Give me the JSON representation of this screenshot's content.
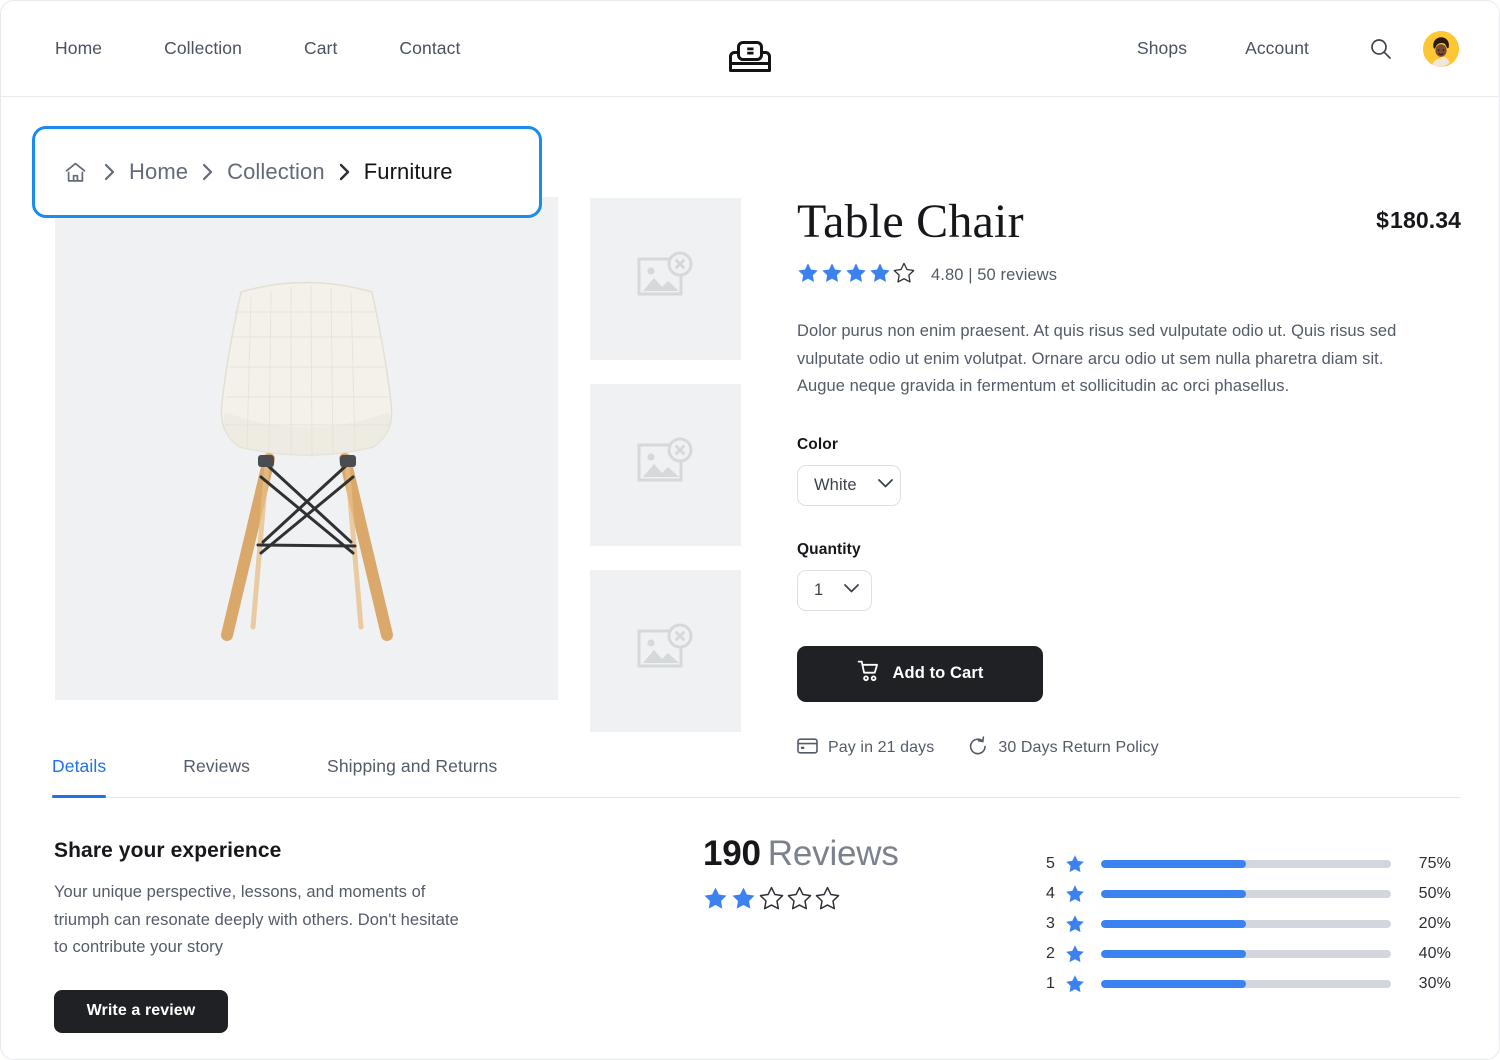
{
  "header": {
    "nav_left": [
      {
        "label": "Home"
      },
      {
        "label": "Collection"
      },
      {
        "label": "Cart"
      },
      {
        "label": "Contact"
      }
    ],
    "nav_right": [
      {
        "label": "Shops"
      },
      {
        "label": "Account"
      }
    ],
    "logo_icon": "sofa-logo-icon",
    "search_icon": "search-icon",
    "avatar_icon": "user-avatar",
    "avatar_bg": "#fcc635"
  },
  "breadcrumb": {
    "home_icon": "home-icon",
    "separator": "chevron-right-icon",
    "highlight_color": "#1a8cf0",
    "items": [
      {
        "label": "Home",
        "current": false
      },
      {
        "label": "Collection",
        "current": false
      },
      {
        "label": "Furniture",
        "current": true
      }
    ]
  },
  "product": {
    "main_image_alt": "white-eames-style-chair",
    "thumbnails": [
      {
        "icon": "broken-image-icon"
      },
      {
        "icon": "broken-image-icon"
      },
      {
        "icon": "broken-image-icon"
      }
    ],
    "title": "Table Chair",
    "currency": "$",
    "price": "180.34",
    "rating_value": 4.8,
    "rating_filled_stars": 4,
    "rating_total_stars": 5,
    "rating_text": "4.80 | 50 reviews",
    "description": "Dolor purus non enim praesent. At quis risus sed vulputate odio ut. Quis risus sed vulputate odio ut enim volutpat. Ornare arcu odio ut sem nulla pharetra diam sit. Augue neque gravida in fermentum et sollicitudin ac orci phasellus.",
    "color_label": "Color",
    "color_value": "White",
    "color_options": [
      "White"
    ],
    "quantity_label": "Quantity",
    "quantity_value": "1",
    "quantity_options": [
      "1"
    ],
    "add_to_cart_label": "Add to Cart",
    "cart_icon": "shopping-cart-icon",
    "perks": [
      {
        "icon": "credit-card-icon",
        "label": "Pay in 21 days"
      },
      {
        "icon": "return-arrow-icon",
        "label": "30 Days Return Policy"
      }
    ]
  },
  "tabs": [
    {
      "label": "Details",
      "active": true
    },
    {
      "label": "Reviews",
      "active": false
    },
    {
      "label": "Shipping and Returns",
      "active": false
    }
  ],
  "share": {
    "heading": "Share your experience",
    "body": "Your unique perspective, lessons, and moments of triumph can resonate deeply with others. Don't hesitate to contribute your story",
    "button_label": "Write a review"
  },
  "reviews": {
    "count": "190",
    "count_word": "Reviews",
    "filled_stars": 2,
    "total_stars": 5
  },
  "chart_data": {
    "type": "bar",
    "title": "Rating distribution",
    "categories": [
      "5",
      "4",
      "3",
      "2",
      "1"
    ],
    "values": [
      75,
      50,
      20,
      40,
      30
    ],
    "value_labels": [
      "75%",
      "50%",
      "20%",
      "40%",
      "30%"
    ],
    "bar_display_fill_pct": [
      50,
      50,
      50,
      50,
      50
    ],
    "star_icon": "star-filled-icon",
    "fill_color": "#3b82f0",
    "track_color": "#d3d7dd",
    "xlabel": "",
    "ylabel": "",
    "xlim": [
      0,
      100
    ],
    "grid": false,
    "legend": "none"
  },
  "colors": {
    "accent_blue": "#1a73e8",
    "highlight_blue": "#1a8cf0",
    "star_blue": "#3b82f0",
    "dark_button": "#1f2124",
    "text_muted": "#545b68",
    "placeholder_bg": "#eff1f2"
  }
}
